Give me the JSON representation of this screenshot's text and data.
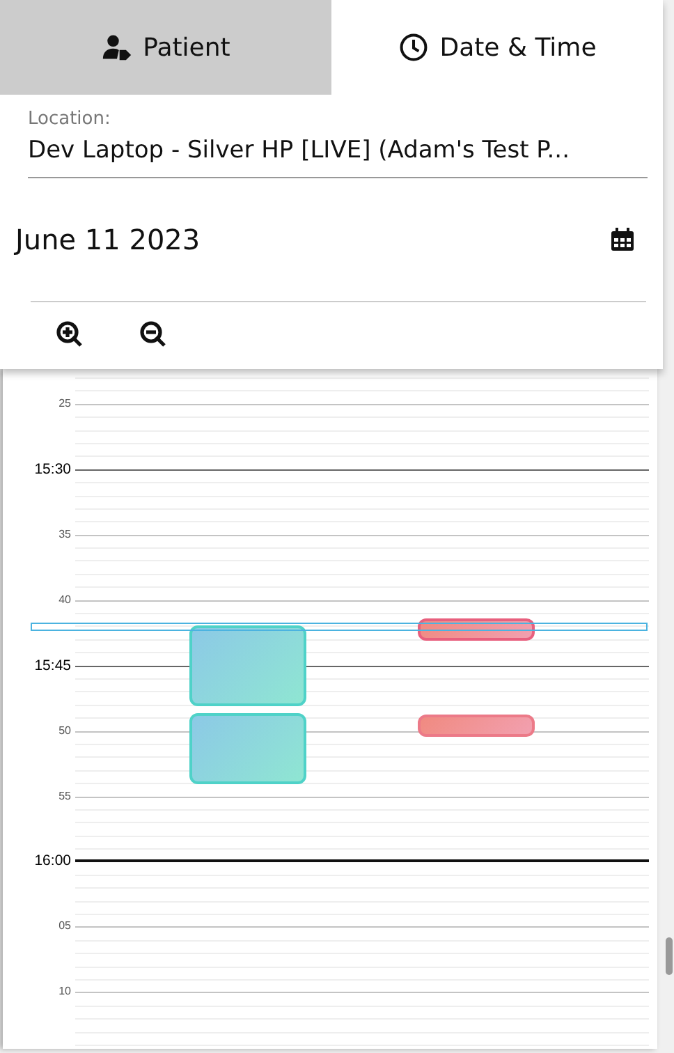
{
  "tabs": [
    {
      "label": "Patient",
      "selected": false
    },
    {
      "label": "Date & Time",
      "selected": true
    }
  ],
  "location": {
    "label": "Location:",
    "value": "Dev Laptop - Silver HP [LIVE] (Adam's Test P..."
  },
  "date": "June 11 2023",
  "timeline": {
    "ticks": [
      {
        "label": "25",
        "kind": "five"
      },
      {
        "label": "15:30",
        "kind": "quarter"
      },
      {
        "label": "35",
        "kind": "five"
      },
      {
        "label": "40",
        "kind": "five"
      },
      {
        "label": "15:45",
        "kind": "quarter"
      },
      {
        "label": "50",
        "kind": "five"
      },
      {
        "label": "55",
        "kind": "five"
      },
      {
        "label": "16:00",
        "kind": "hour"
      },
      {
        "label": "05",
        "kind": "five"
      },
      {
        "label": "10",
        "kind": "five"
      }
    ],
    "events": [
      {
        "color": "#4fd2c8"
      },
      {
        "color": "#4fd2c8"
      },
      {
        "color": "#e8607e"
      },
      {
        "color": "#ec7a88"
      }
    ]
  }
}
